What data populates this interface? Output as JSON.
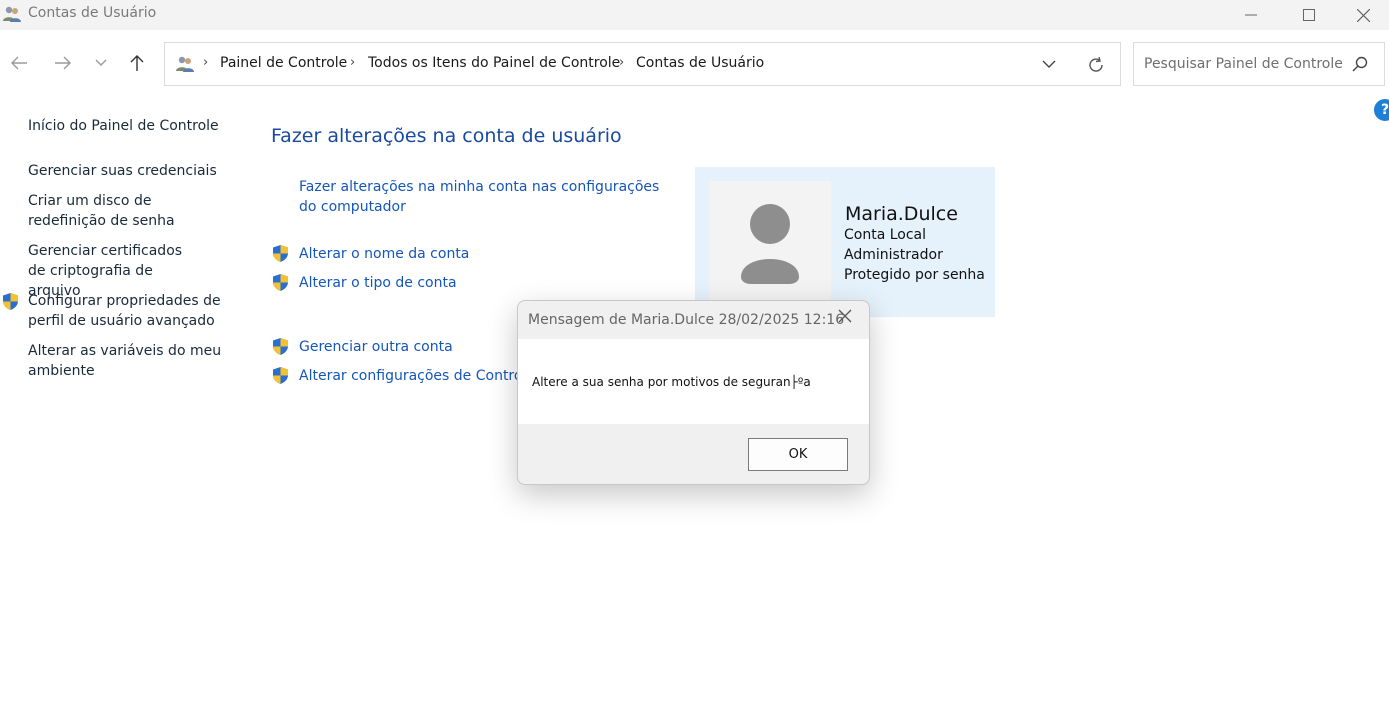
{
  "window": {
    "title": "Contas de Usuário"
  },
  "address": {
    "breadcrumbs": [
      "Painel de Controle",
      "Todos os Itens do Painel de Controle",
      "Contas de Usuário"
    ]
  },
  "search": {
    "placeholder": "Pesquisar Painel de Controle"
  },
  "sidebar": {
    "items": [
      {
        "label": "Início do Painel de Controle",
        "icon": null
      },
      {
        "label": "Gerenciar suas credenciais",
        "icon": null
      },
      {
        "label": "Criar um disco de redefinição de senha",
        "icon": null
      },
      {
        "label": "Gerenciar certificados de criptografia de arquivo",
        "icon": null
      },
      {
        "label": "Configurar propriedades de perfil de usuário avançado",
        "icon": "uac-shield-icon"
      },
      {
        "label": "Alterar as variáveis do meu ambiente",
        "icon": null
      }
    ]
  },
  "main": {
    "title": "Fazer alterações na conta de usuário",
    "links": [
      {
        "label": "Fazer alterações na minha conta nas configurações do computador"
      },
      {
        "label": "Alterar o nome da conta",
        "icon": "uac-shield-icon"
      },
      {
        "label": "Alterar o tipo de conta",
        "icon": "uac-shield-icon"
      },
      {
        "label": "Gerenciar outra conta",
        "icon": "uac-shield-icon"
      },
      {
        "label": "Alterar configurações de Controle de Conta de Usuário",
        "icon": "uac-shield-icon"
      }
    ]
  },
  "user": {
    "name": "Maria.Dulce",
    "lines": [
      "Conta Local",
      "Administrador",
      "Protegido por senha"
    ]
  },
  "dialog": {
    "title": "Mensagem de Maria.Dulce 28/02/2025 12:16",
    "message": "Altere a sua senha por motivos de seguran├ºa",
    "ok_label": "OK"
  },
  "colors": {
    "link": "#1556b8",
    "title": "#1a4aa0",
    "card_bg": "#e5f1fb",
    "help": "#1e7fd6"
  }
}
